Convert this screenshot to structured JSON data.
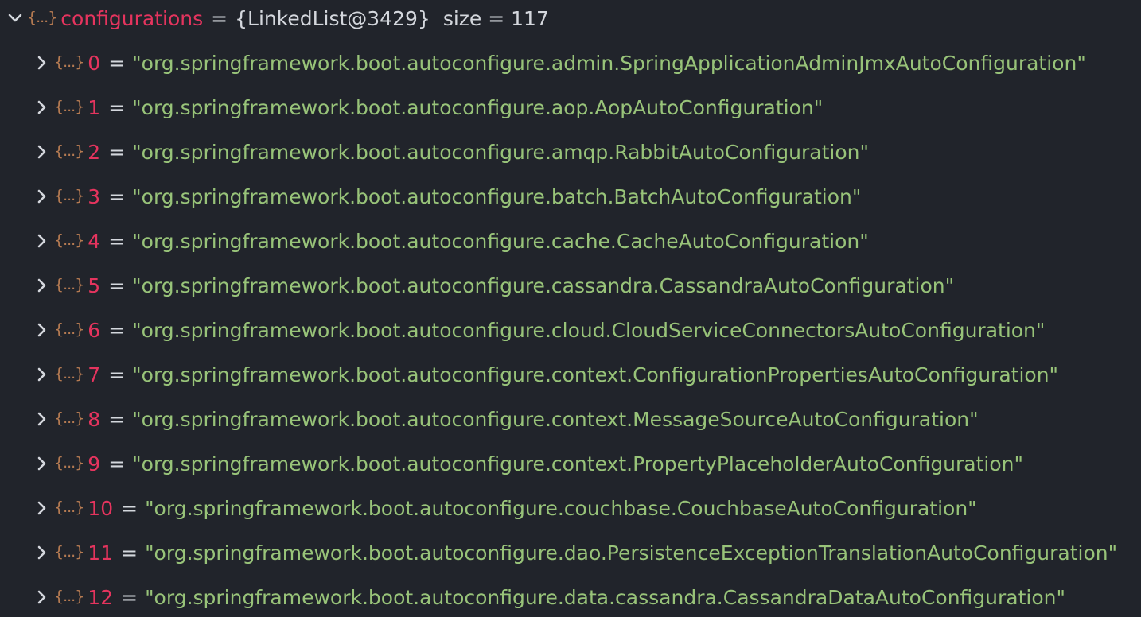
{
  "root": {
    "name": "configurations",
    "equals": "=",
    "type": "{LinkedList@3429}",
    "size": "size = 117",
    "icon": "object-icon",
    "icon_glyph": "{...}"
  },
  "items": [
    {
      "index": "0",
      "value": "\"org.springframework.boot.autoconfigure.admin.SpringApplicationAdminJmxAutoConfiguration\""
    },
    {
      "index": "1",
      "value": "\"org.springframework.boot.autoconfigure.aop.AopAutoConfiguration\""
    },
    {
      "index": "2",
      "value": "\"org.springframework.boot.autoconfigure.amqp.RabbitAutoConfiguration\""
    },
    {
      "index": "3",
      "value": "\"org.springframework.boot.autoconfigure.batch.BatchAutoConfiguration\""
    },
    {
      "index": "4",
      "value": "\"org.springframework.boot.autoconfigure.cache.CacheAutoConfiguration\""
    },
    {
      "index": "5",
      "value": "\"org.springframework.boot.autoconfigure.cassandra.CassandraAutoConfiguration\""
    },
    {
      "index": "6",
      "value": "\"org.springframework.boot.autoconfigure.cloud.CloudServiceConnectorsAutoConfiguration\""
    },
    {
      "index": "7",
      "value": "\"org.springframework.boot.autoconfigure.context.ConfigurationPropertiesAutoConfiguration\""
    },
    {
      "index": "8",
      "value": "\"org.springframework.boot.autoconfigure.context.MessageSourceAutoConfiguration\""
    },
    {
      "index": "9",
      "value": "\"org.springframework.boot.autoconfigure.context.PropertyPlaceholderAutoConfiguration\""
    },
    {
      "index": "10",
      "value": "\"org.springframework.boot.autoconfigure.couchbase.CouchbaseAutoConfiguration\""
    },
    {
      "index": "11",
      "value": "\"org.springframework.boot.autoconfigure.dao.PersistenceExceptionTranslationAutoConfiguration\""
    },
    {
      "index": "12",
      "value": "\"org.springframework.boot.autoconfigure.data.cassandra.CassandraDataAutoConfiguration\""
    }
  ],
  "colors": {
    "background": "#21242b",
    "name": "#e5345e",
    "string": "#98c379",
    "icon": "#b67b52",
    "text": "#d4d7dd"
  }
}
